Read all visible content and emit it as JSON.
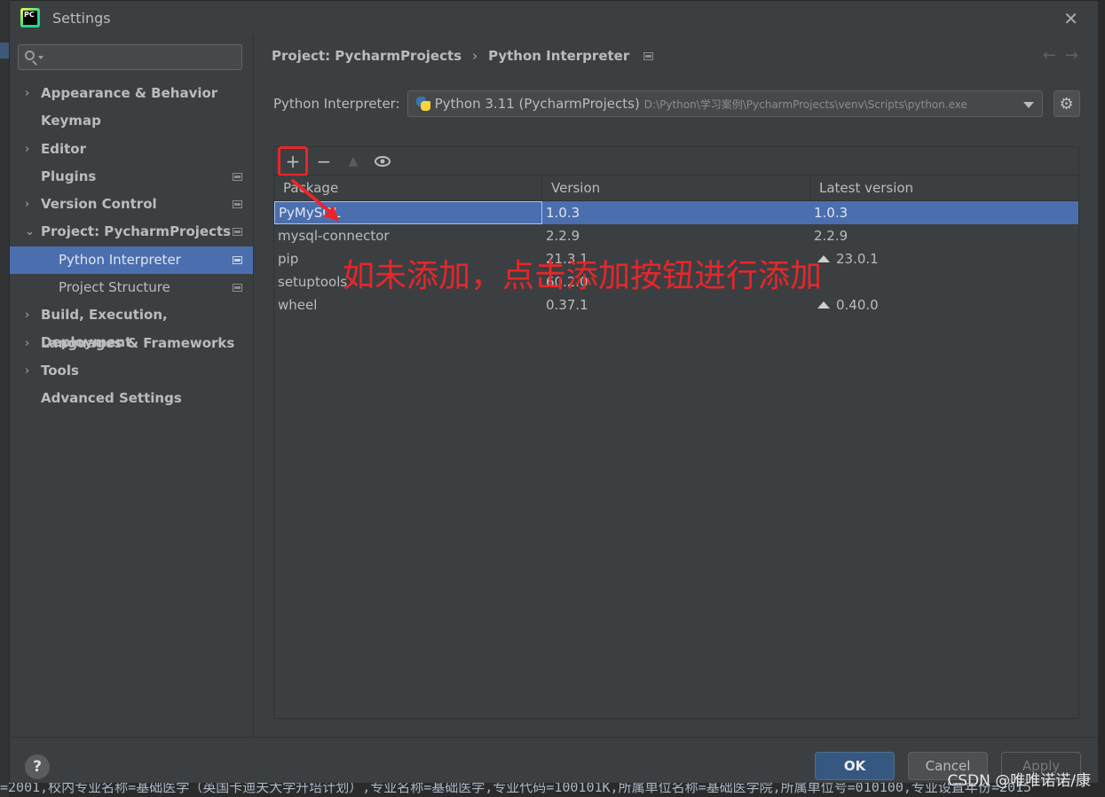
{
  "window": {
    "title": "Settings"
  },
  "sidebar": {
    "search_placeholder": "",
    "items": [
      {
        "label": "Appearance & Behavior",
        "arrow": "›"
      },
      {
        "label": "Keymap"
      },
      {
        "label": "Editor",
        "arrow": "›"
      },
      {
        "label": "Plugins"
      },
      {
        "label": "Version Control",
        "arrow": "›"
      },
      {
        "label": "Project: PycharmProjects",
        "arrow": "⌄"
      },
      {
        "label": "Python Interpreter"
      },
      {
        "label": "Project Structure"
      },
      {
        "label": "Build, Execution, Deployment",
        "arrow": "›"
      },
      {
        "label": "Languages & Frameworks",
        "arrow": "›"
      },
      {
        "label": "Tools",
        "arrow": "›"
      },
      {
        "label": "Advanced Settings"
      }
    ]
  },
  "breadcrumb": {
    "project": "Project: PycharmProjects",
    "separator": "›",
    "page": "Python Interpreter"
  },
  "nav": {
    "back": "←",
    "forward": "→"
  },
  "interpreter": {
    "label": "Python Interpreter:",
    "name": "Python 3.11 (PycharmProjects)",
    "path": "D:\\Python\\学习案例\\PycharmProjects\\venv\\Scripts\\python.exe",
    "gear": "⚙"
  },
  "toolbar": {
    "add": "+",
    "remove": "−",
    "up": "▲",
    "show": "👁"
  },
  "table": {
    "headers": [
      "Package",
      "Version",
      "Latest version"
    ],
    "rows": [
      {
        "package": "PyMySQL",
        "version": "1.0.3",
        "latest": "1.0.3",
        "upgrade": false
      },
      {
        "package": "mysql-connector",
        "version": "2.2.9",
        "latest": "2.2.9",
        "upgrade": false
      },
      {
        "package": "pip",
        "version": "21.3.1",
        "latest": "23.0.1",
        "upgrade": true
      },
      {
        "package": "setuptools",
        "version": "60.2.0",
        "latest": "",
        "upgrade": false
      },
      {
        "package": "wheel",
        "version": "0.37.1",
        "latest": "0.40.0",
        "upgrade": true
      }
    ]
  },
  "annotation": {
    "text": "如未添加，点击添加按钮进行添加",
    "color": "#e8262a"
  },
  "footer": {
    "help": "?",
    "ok": "OK",
    "cancel": "Cancel",
    "apply": "Apply"
  },
  "watermark": "CSDN @唯唯诺诺/康",
  "background_text": "=2001,校内专业名称=基础医学（英国卡迪夫大学升培计划）,专业名称=基础医学,专业代码=100101K,所属单位名称=基础医学院,所属单位号=010100,专业设置年份=2015"
}
